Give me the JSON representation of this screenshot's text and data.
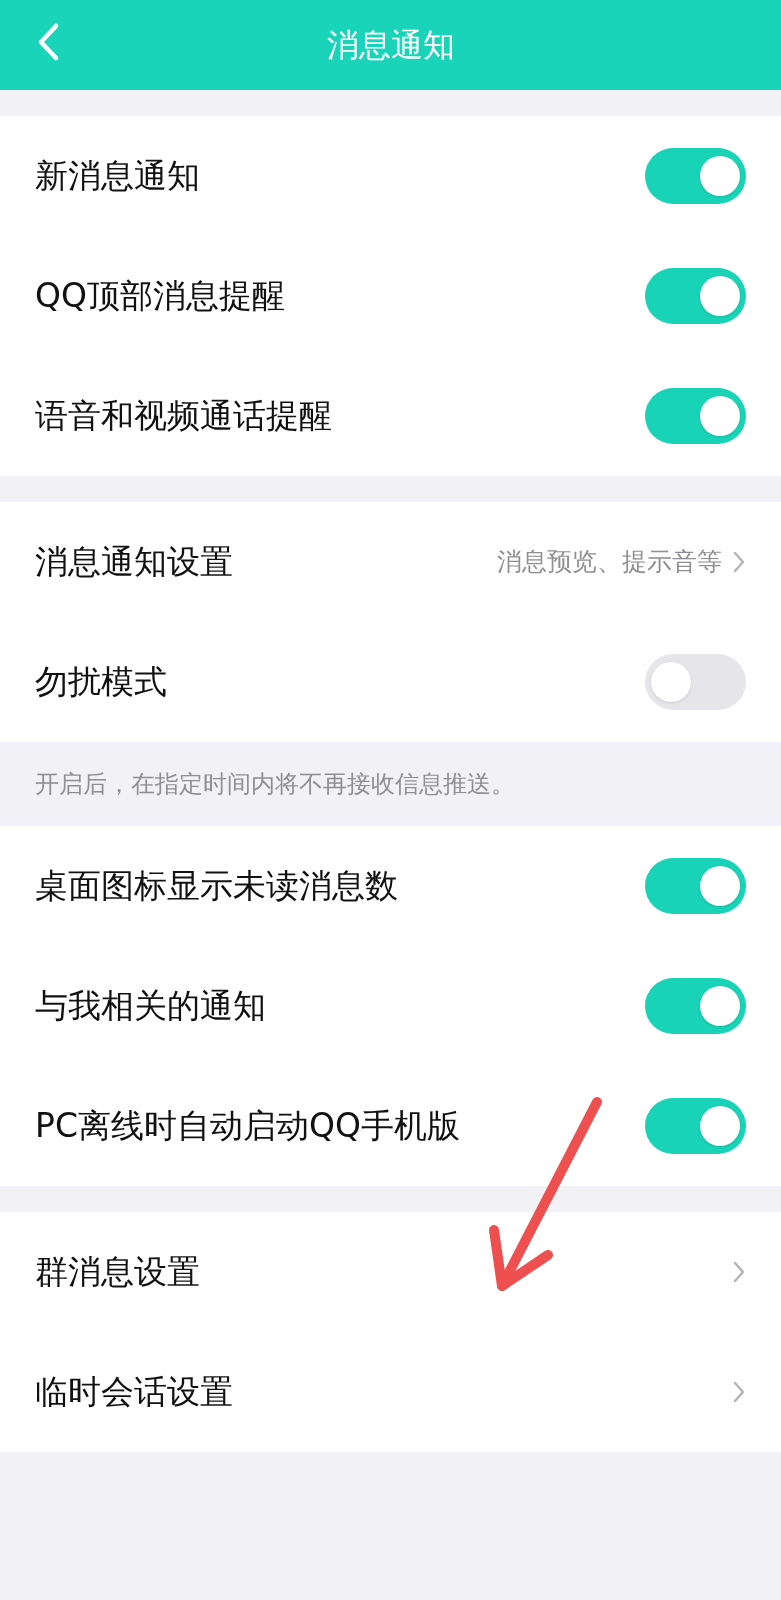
{
  "header": {
    "title": "消息通知"
  },
  "sections": [
    {
      "rows": [
        {
          "kind": "toggle",
          "label": "新消息通知",
          "on": true
        },
        {
          "kind": "toggle",
          "label": "QQ顶部消息提醒",
          "on": true
        },
        {
          "kind": "toggle",
          "label": "语音和视频通话提醒",
          "on": true
        }
      ]
    },
    {
      "rows": [
        {
          "kind": "link",
          "label": "消息通知设置",
          "value": "消息预览、提示音等"
        },
        {
          "kind": "toggle",
          "label": "勿扰模式",
          "on": false
        }
      ],
      "note": "开启后，在指定时间内将不再接收信息推送。"
    },
    {
      "rows": [
        {
          "kind": "toggle",
          "label": "桌面图标显示未读消息数",
          "on": true
        },
        {
          "kind": "toggle",
          "label": "与我相关的通知",
          "on": true
        },
        {
          "kind": "toggle",
          "label": "PC离线时自动启动QQ手机版",
          "on": true
        }
      ]
    },
    {
      "rows": [
        {
          "kind": "link",
          "label": "群消息设置"
        },
        {
          "kind": "link",
          "label": "临时会话设置"
        }
      ]
    }
  ]
}
